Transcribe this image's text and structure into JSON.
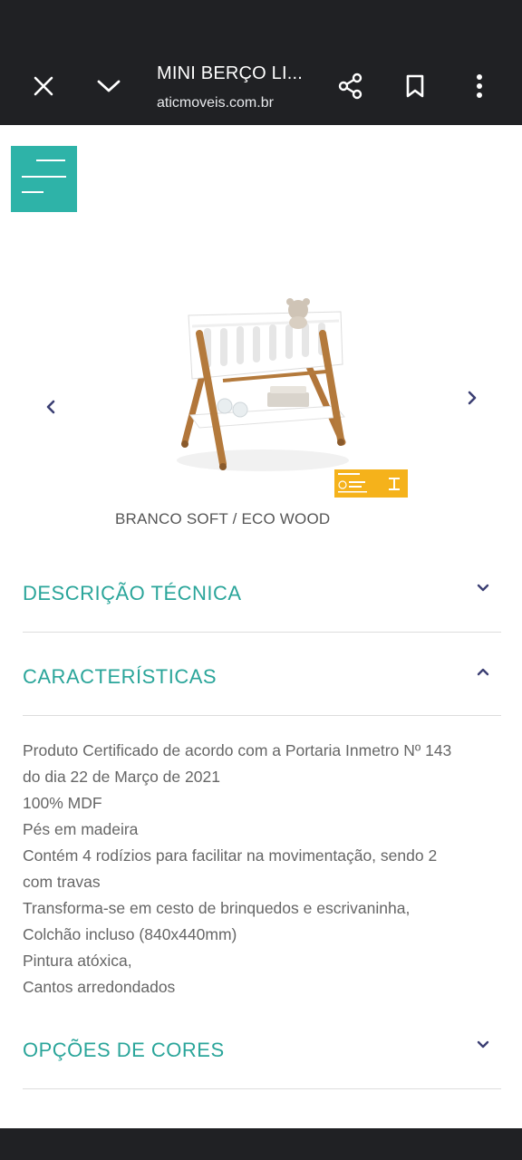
{
  "browser": {
    "page_title": "MINI BERÇO LI...",
    "url": "aticmoveis.com.br",
    "close_icon": "close-icon",
    "collapse_icon": "chevron-down-icon",
    "share_icon": "share-icon",
    "bookmark_icon": "bookmark-icon",
    "more_icon": "more-vertical-icon"
  },
  "site": {
    "menu_icon": "hamburger-menu-icon",
    "accent_color": "#2eb3a8"
  },
  "product": {
    "image": "mini-crib-white-wood-image",
    "seal": "safety-certification-seal",
    "seal_color": "#f5b21b",
    "variant": "BRANCO SOFT / ECO WOOD",
    "prev_icon": "chevron-left-icon",
    "next_icon": "chevron-right-icon"
  },
  "sections": {
    "description": {
      "title": "DESCRIÇÃO TÉCNICA",
      "expanded": false
    },
    "features": {
      "title": "CARACTERÍSTICAS",
      "expanded": true,
      "lines": [
        "Produto Certificado de acordo com a Portaria Inmetro Nº 143",
        "do dia 22 de Março de 2021",
        "100% MDF",
        "Pés em madeira",
        "Contém 4 rodízios para facilitar na movimentação, sendo 2",
        "com travas",
        "Transforma-se em cesto de brinquedos e escrivaninha,",
        "Colchão incluso (840x440mm)",
        "Pintura atóxica,",
        "Cantos arredondados"
      ]
    },
    "colors": {
      "title": "OPÇÕES DE CORES",
      "expanded": false
    }
  }
}
